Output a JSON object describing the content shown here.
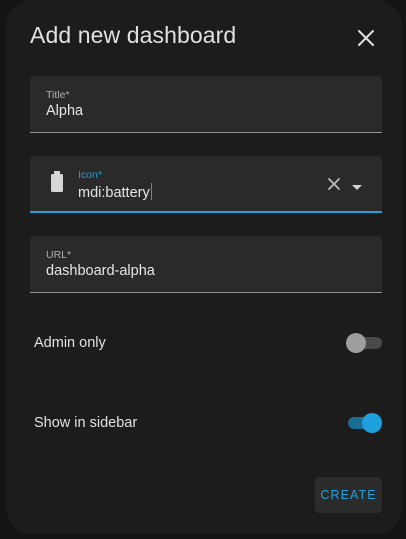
{
  "dialog": {
    "title": "Add new dashboard",
    "close_icon": "close-icon"
  },
  "fields": {
    "title": {
      "label": "Title*",
      "value": "Alpha"
    },
    "icon": {
      "label": "Icon*",
      "value": "mdi:battery",
      "icon": "battery-icon",
      "clear_icon": "clear-icon",
      "dropdown_icon": "chevron-down-icon"
    },
    "url": {
      "label": "URL*",
      "value": "dashboard-alpha"
    }
  },
  "toggles": {
    "admin_only": {
      "label": "Admin only",
      "checked": false
    },
    "show_in_sidebar": {
      "label": "Show in sidebar",
      "checked": true
    }
  },
  "actions": {
    "create_label": "CREATE"
  },
  "colors": {
    "accent": "#1ea1dc",
    "dialog_bg": "#1c1c1c",
    "field_bg": "#2a2a2a"
  }
}
